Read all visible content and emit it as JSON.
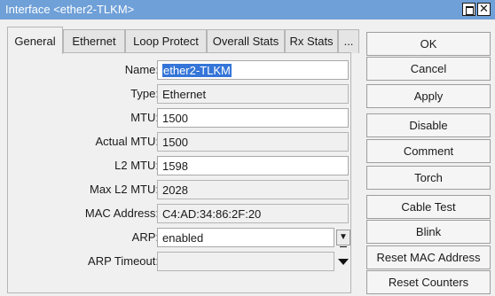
{
  "window": {
    "title": "Interface <ether2-TLKM>",
    "restore_glyph": "",
    "close_glyph": "✕"
  },
  "tabs": [
    {
      "label": "General",
      "active": true
    },
    {
      "label": "Ethernet",
      "active": false
    },
    {
      "label": "Loop Protect",
      "active": false
    },
    {
      "label": "Overall Stats",
      "active": false
    },
    {
      "label": "Rx Stats",
      "active": false
    },
    {
      "label": "...",
      "active": false
    }
  ],
  "fields": {
    "name": {
      "label": "Name:",
      "value": "ether2-TLKM"
    },
    "type": {
      "label": "Type:",
      "value": "Ethernet"
    },
    "mtu": {
      "label": "MTU:",
      "value": "1500"
    },
    "actual_mtu": {
      "label": "Actual MTU:",
      "value": "1500"
    },
    "l2_mtu": {
      "label": "L2 MTU:",
      "value": "1598"
    },
    "max_l2_mtu": {
      "label": "Max L2 MTU:",
      "value": "2028"
    },
    "mac_address": {
      "label": "MAC Address:",
      "value": "C4:AD:34:86:2F:20"
    },
    "arp": {
      "label": "ARP:",
      "value": "enabled"
    },
    "arp_timeout": {
      "label": "ARP Timeout:",
      "value": ""
    }
  },
  "buttons": {
    "ok": "OK",
    "cancel": "Cancel",
    "apply": "Apply",
    "disable": "Disable",
    "comment": "Comment",
    "torch": "Torch",
    "cable_test": "Cable Test",
    "blink": "Blink",
    "reset_mac": "Reset MAC Address",
    "reset_counters": "Reset Counters"
  },
  "icons": {
    "arp_dropdown": "dropdown-icon",
    "arp_timeout_dropdown": "triangle-down-icon"
  }
}
